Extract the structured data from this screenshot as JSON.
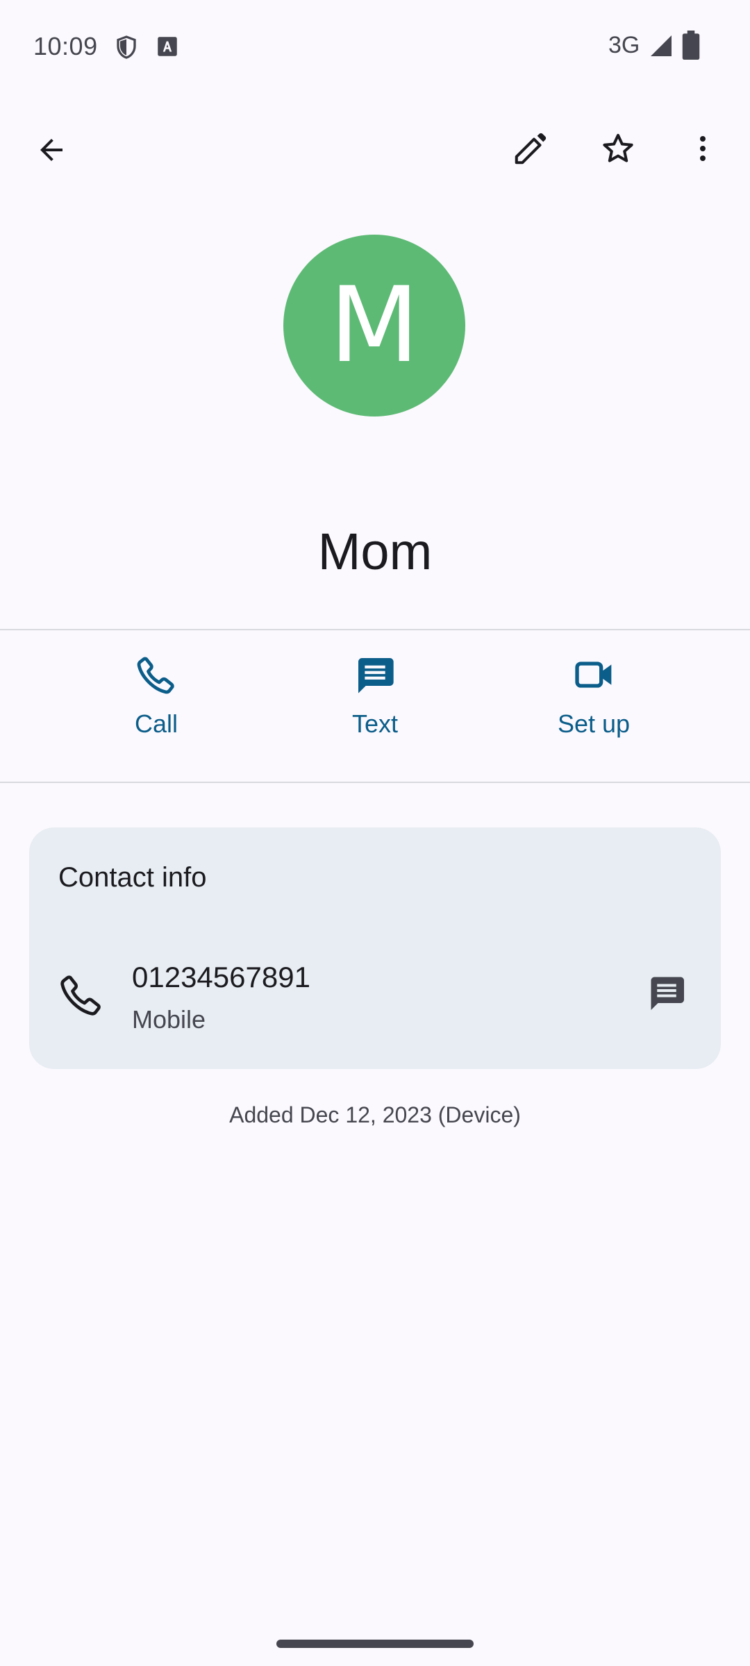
{
  "status_bar": {
    "time": "10:09",
    "network": "3G",
    "icons": [
      "shield-icon",
      "keyboard-a-icon",
      "signal-icon",
      "battery-icon"
    ]
  },
  "top_bar": {
    "icons": [
      "back-arrow-icon",
      "edit-pencil-icon",
      "star-outline-icon",
      "more-vert-icon"
    ]
  },
  "contact": {
    "initial": "M",
    "name": "Mom",
    "avatar_color": "#5dba75"
  },
  "actions": [
    {
      "label": "Call",
      "icon": "phone-icon"
    },
    {
      "label": "Text",
      "icon": "message-icon"
    },
    {
      "label": "Set up",
      "icon": "video-call-icon"
    }
  ],
  "contact_info": {
    "title": "Contact info",
    "phone": {
      "number": "01234567891",
      "type": "Mobile"
    }
  },
  "added_note": "Added Dec 12, 2023 (Device)",
  "colors": {
    "accent": "#0b5d8a",
    "background": "#fbf9fd",
    "card": "#e7edf3"
  }
}
